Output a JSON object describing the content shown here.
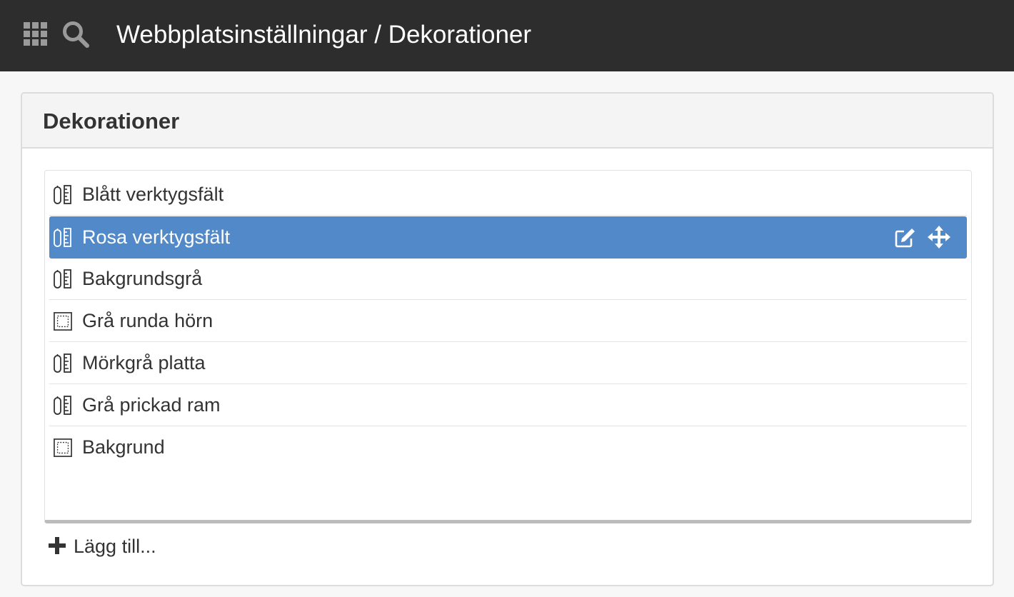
{
  "topbar": {
    "apps_icon": "apps-grid-icon",
    "search_icon": "search-icon",
    "title": "Webbplatsinställningar / Dekorationer"
  },
  "panel": {
    "title": "Dekorationer"
  },
  "decorations": [
    {
      "label": "Blått verktygsfält",
      "icon": "toolbar-decoration-icon"
    },
    {
      "label": "Rosa verktygsfält",
      "icon": "toolbar-decoration-icon",
      "selected": true
    },
    {
      "label": "Bakgrundsgrå",
      "icon": "toolbar-decoration-icon"
    },
    {
      "label": "Grå runda hörn",
      "icon": "frame-decoration-icon"
    },
    {
      "label": "Mörkgrå platta",
      "icon": "toolbar-decoration-icon"
    },
    {
      "label": "Grå prickad ram",
      "icon": "toolbar-decoration-icon"
    },
    {
      "label": "Bakgrund",
      "icon": "frame-decoration-icon"
    }
  ],
  "row_actions": {
    "edit_icon": "edit-icon",
    "move_icon": "move-icon"
  },
  "add": {
    "label": "Lägg till...",
    "icon": "plus-icon"
  },
  "colors": {
    "topbar": "#2d2d2d",
    "selected_row": "#5289c8",
    "page_background": "#f7f7f7"
  }
}
